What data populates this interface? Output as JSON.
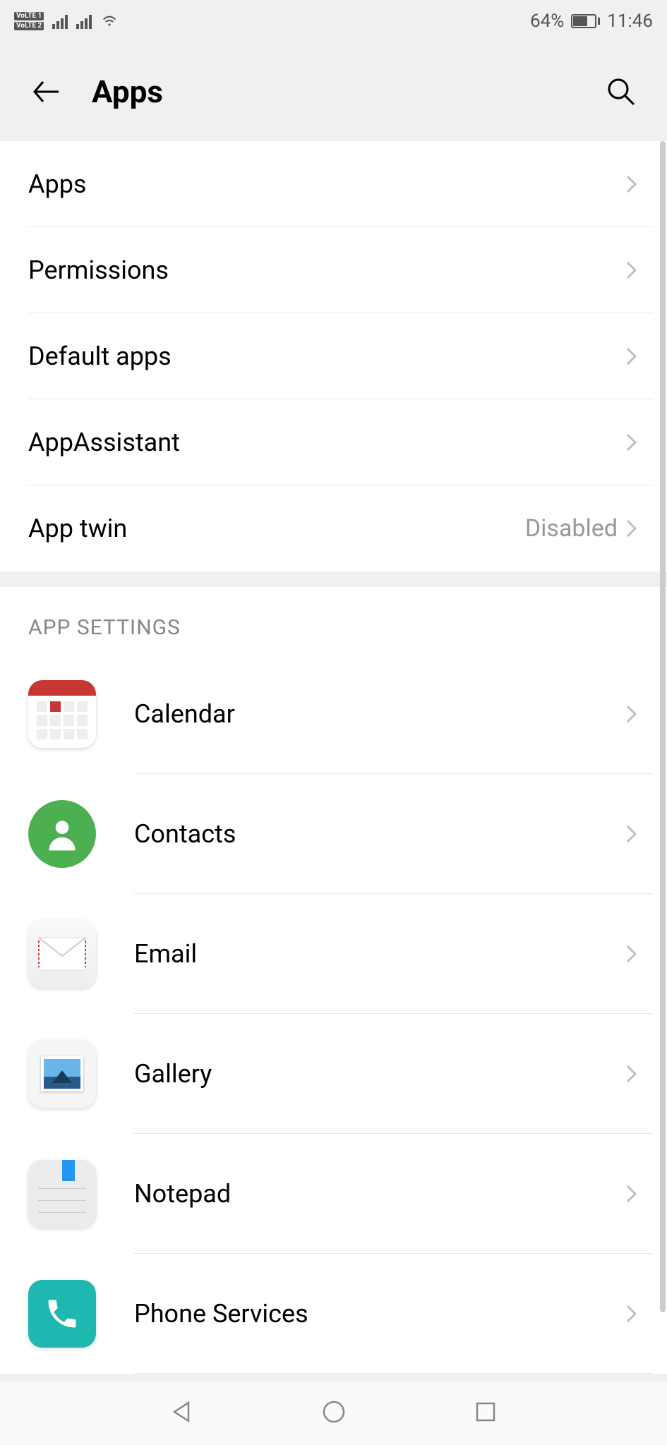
{
  "status_bar": {
    "battery_percent": "64%",
    "time": "11:46"
  },
  "header": {
    "title": "Apps"
  },
  "menu": {
    "items": [
      {
        "label": "Apps",
        "value": ""
      },
      {
        "label": "Permissions",
        "value": ""
      },
      {
        "label": "Default apps",
        "value": ""
      },
      {
        "label": "AppAssistant",
        "value": ""
      },
      {
        "label": "App twin",
        "value": "Disabled"
      }
    ]
  },
  "app_settings": {
    "header": "APP SETTINGS",
    "apps": [
      {
        "label": "Calendar",
        "icon": "calendar"
      },
      {
        "label": "Contacts",
        "icon": "contacts"
      },
      {
        "label": "Email",
        "icon": "email"
      },
      {
        "label": "Gallery",
        "icon": "gallery"
      },
      {
        "label": "Notepad",
        "icon": "notepad"
      },
      {
        "label": "Phone Services",
        "icon": "phone"
      }
    ]
  }
}
